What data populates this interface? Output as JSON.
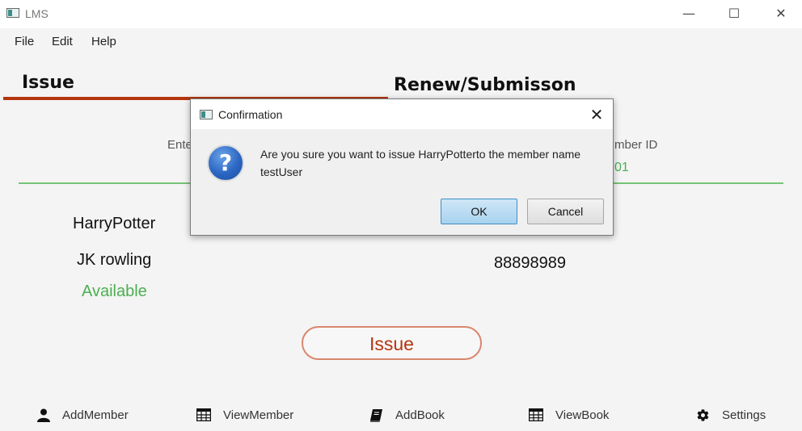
{
  "window": {
    "title": "LMS",
    "minimize_glyph": "—",
    "maximize_glyph": "☐",
    "close_glyph": "✕"
  },
  "menu": [
    "File",
    "Edit",
    "Help"
  ],
  "tabs": {
    "issue": "Issue",
    "renew": "Renew/Submisson"
  },
  "issue_panel": {
    "book_label_partial": "Ente",
    "member_label_partial": "mber ID",
    "member_value_partial": "01",
    "book_name": "HarryPotter",
    "author": "JK rowling",
    "status": "Available",
    "member_mobile": "88898989",
    "issue_button": "Issue"
  },
  "bottom_nav": [
    {
      "label": "AddMember",
      "icon": "user-icon"
    },
    {
      "label": "ViewMember",
      "icon": "table-icon"
    },
    {
      "label": "AddBook",
      "icon": "book-icon"
    },
    {
      "label": "ViewBook",
      "icon": "table-icon"
    },
    {
      "label": "Settings",
      "icon": "gear-icon"
    }
  ],
  "dialog": {
    "title": "Confirmation",
    "close_glyph": "✕",
    "question_glyph": "?",
    "message_line1": "Are you sure you want to issue HarryPotterto the member name",
    "message_line2": "testUser",
    "ok": "OK",
    "cancel": "Cancel"
  },
  "colors": {
    "accent": "#b5360f",
    "green": "#4caf50",
    "ok_border": "#3c8fc4"
  }
}
